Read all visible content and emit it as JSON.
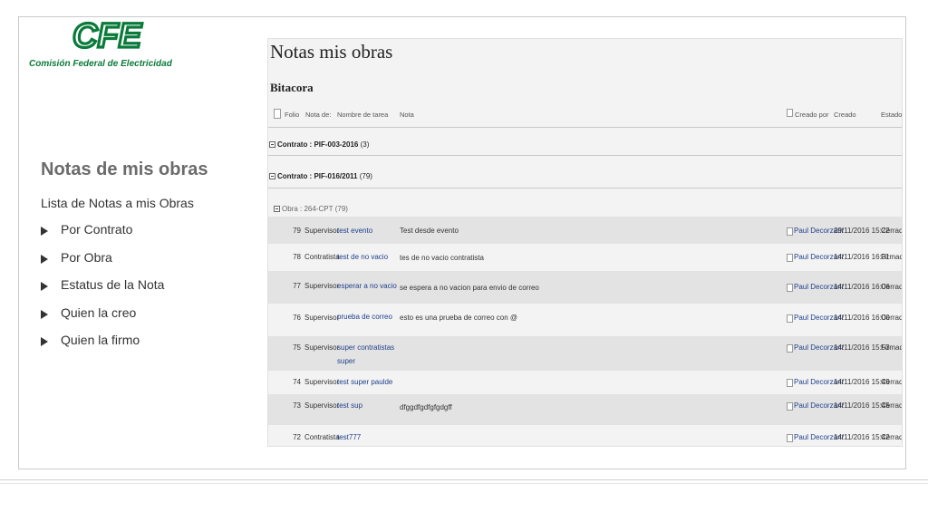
{
  "logo": {
    "brand": "CFE",
    "name": "Comisión Federal de Electricidad",
    "color": "#0a7a3a"
  },
  "left": {
    "title": "Notas de mis obras",
    "subtitle": "Lista de Notas a mis Obras",
    "bullets": [
      "Por  Contrato",
      "Por  Obra",
      "Estatus de la Nota",
      "Quien la creo",
      "Quien la firmo"
    ]
  },
  "shot": {
    "title": "Notas mis obras",
    "section": "Bitacora",
    "headers": {
      "folio": "Folio",
      "nota_de": "Nota de:",
      "nombre": "Nombre de tarea",
      "nota": "Nota",
      "creado_por": "Creado por",
      "creado": "Creado",
      "estado": "Estado de"
    },
    "groups": [
      {
        "label": "Contrato : PIF-003-2016",
        "count": "(3)"
      },
      {
        "label": "Contrato : PIF-016/2011",
        "count": "(79)"
      },
      {
        "label": "Obra : 264-CPT",
        "count": "(79)"
      }
    ],
    "rows": [
      {
        "folio": "79",
        "nota_de": "Supervisor",
        "nombre": "test evento",
        "nombre2": "",
        "nota": "Test desde evento",
        "creado_por": "Paul Decorzant",
        "creado": "29/11/2016 15:22",
        "estado": "Cerrada"
      },
      {
        "folio": "78",
        "nota_de": "Contratista",
        "nombre": "test de no vacio",
        "nombre2": "",
        "nota": "tes de no vacio contratista",
        "creado_por": "Paul Decorzant",
        "creado": "14/11/2016 16:31",
        "estado": "Firmada"
      },
      {
        "folio": "77",
        "nota_de": "Supervisor",
        "nombre": "esperar a no vacio",
        "nombre2": "",
        "nota": "se espera a no vacion para envio de correo",
        "creado_por": "Paul Decorzant",
        "creado": "14/11/2016 16:06",
        "estado": "Cerrada"
      },
      {
        "folio": "76",
        "nota_de": "Supervisor",
        "nombre": "prueba de correo",
        "nombre2": "",
        "nota": "esto es una prueba de correo con @",
        "creado_por": "Paul Decorzant",
        "creado": "14/11/2016 16:00",
        "estado": "Cerrada"
      },
      {
        "folio": "75",
        "nota_de": "Supervisor",
        "nombre": "super contratistas",
        "nombre2": "super",
        "nota": "",
        "creado_por": "Paul Decorzant",
        "creado": "14/11/2016 15:53",
        "estado": "Firmada"
      },
      {
        "folio": "74",
        "nota_de": "Supervisor",
        "nombre": "test super paulde",
        "nombre2": "",
        "nota": "",
        "creado_por": "Paul Decorzant",
        "creado": "14/11/2016 15:49",
        "estado": "Cerrada"
      },
      {
        "folio": "73",
        "nota_de": "Supervisor",
        "nombre": "test sup",
        "nombre2": "",
        "nota": "dfggdfgdfgfgdgff",
        "creado_por": "Paul Decorzant",
        "creado": "14/11/2016 15:45",
        "estado": "Cerrada"
      },
      {
        "folio": "72",
        "nota_de": "Contratista",
        "nombre": "test777",
        "nombre2": "",
        "nota": "",
        "creado_por": "Paul Decorzant",
        "creado": "14/11/2016 15:42",
        "estado": "Cerrada"
      }
    ]
  }
}
